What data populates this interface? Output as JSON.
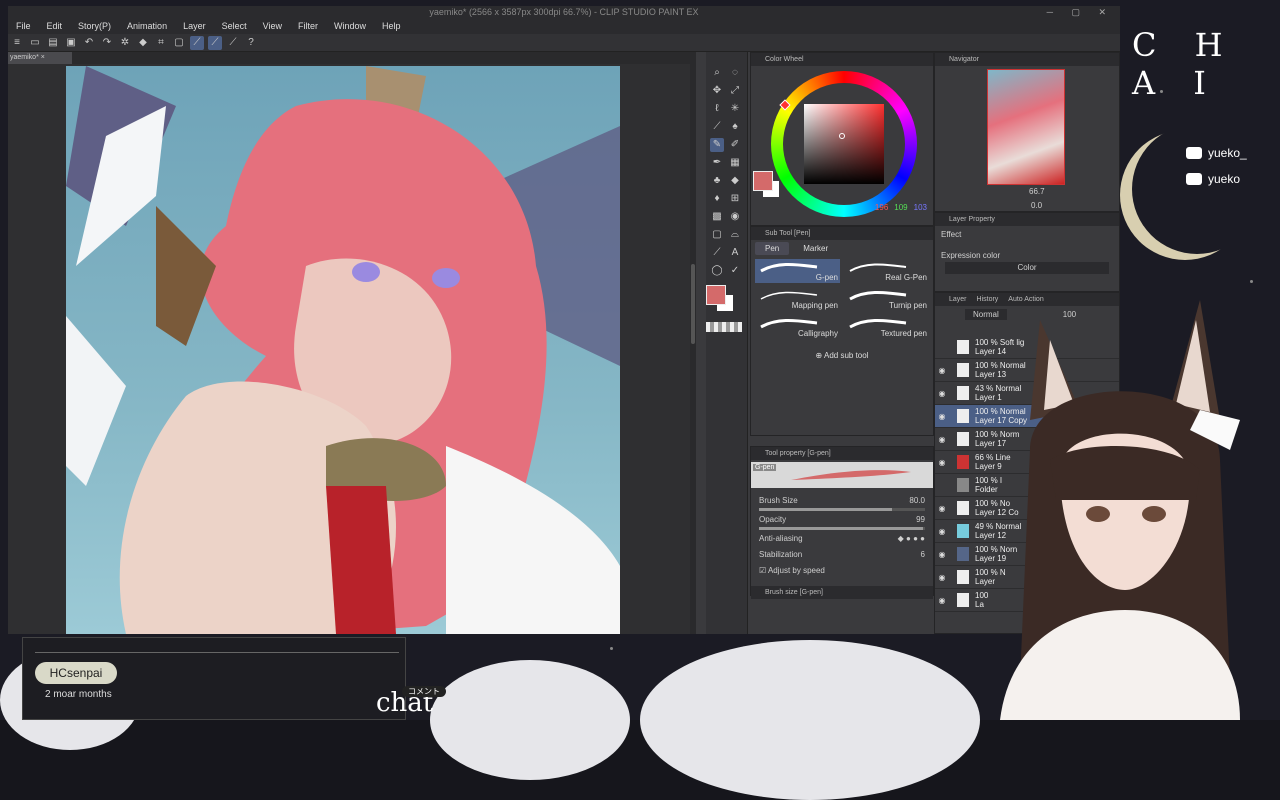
{
  "window": {
    "title": "yaemiko* (2566 x 3587px 300dpi 66.7%) - CLIP STUDIO PAINT EX"
  },
  "menu": [
    "File",
    "Edit",
    "Story(P)",
    "Animation",
    "Layer",
    "Select",
    "View",
    "Filter",
    "Window",
    "Help"
  ],
  "canvas": {
    "tab_label": "yaemiko*"
  },
  "color_wheel": {
    "title": "Color Wheel",
    "r": "196",
    "g": "109",
    "b": "103",
    "main_color": "#d46a6a"
  },
  "navigator": {
    "title": "Navigator",
    "zoom": "66.7",
    "rotation": "0.0"
  },
  "sub_tool": {
    "title": "Sub Tool [Pen]",
    "tabs": [
      "Pen",
      "Marker"
    ],
    "brushes": [
      "G-pen",
      "Real G-Pen",
      "Mapping pen",
      "Turnip pen",
      "Calligraphy",
      "Textured pen"
    ],
    "add_label": "Add sub tool"
  },
  "tool_property": {
    "title": "Tool property [G-pen]",
    "brush_name": "G-pen",
    "brush_size_label": "Brush Size",
    "brush_size": "80.0",
    "opacity_label": "Opacity",
    "opacity": "99",
    "antialias_label": "Anti-aliasing",
    "stabilization_label": "Stabilization",
    "stabilization": "6",
    "adjust_label": "Adjust by speed",
    "brush_size_panel": "Brush size [G-pen]"
  },
  "layer_property": {
    "title": "Layer Property",
    "effect_label": "Effect",
    "expression_label": "Expression color",
    "expression_value": "Color"
  },
  "layer_panel": {
    "tabs": [
      "Layer",
      "History",
      "Auto Action"
    ],
    "blend": "Normal",
    "opacity": "100",
    "layers": [
      {
        "top": "100 % Soft lig",
        "name": "Layer 14"
      },
      {
        "top": "100 % Normal",
        "name": "Layer 13"
      },
      {
        "top": "43 % Normal",
        "name": "Layer 1"
      },
      {
        "top": "100 % Normal",
        "name": "Layer 17 Copy"
      },
      {
        "top": "100 % Norm",
        "name": "Layer 17"
      },
      {
        "top": "66 % Line",
        "name": "Layer 9"
      },
      {
        "top": "100 % I",
        "name": "Folder"
      },
      {
        "top": "100 % No",
        "name": "Layer 12 Co"
      },
      {
        "top": "49 % Normal",
        "name": "Layer 12"
      },
      {
        "top": "100 % Norn",
        "name": "Layer 19"
      },
      {
        "top": "100 % N",
        "name": "Layer"
      },
      {
        "top": "100",
        "name": "La"
      }
    ]
  },
  "overlay": {
    "logo": "C H A I",
    "twitter": "yueko_",
    "youtube": "yueko",
    "chat_user": "HCsenpai",
    "chat_message": "2 moar months",
    "chat_label": "chat",
    "komento": "コメント"
  }
}
